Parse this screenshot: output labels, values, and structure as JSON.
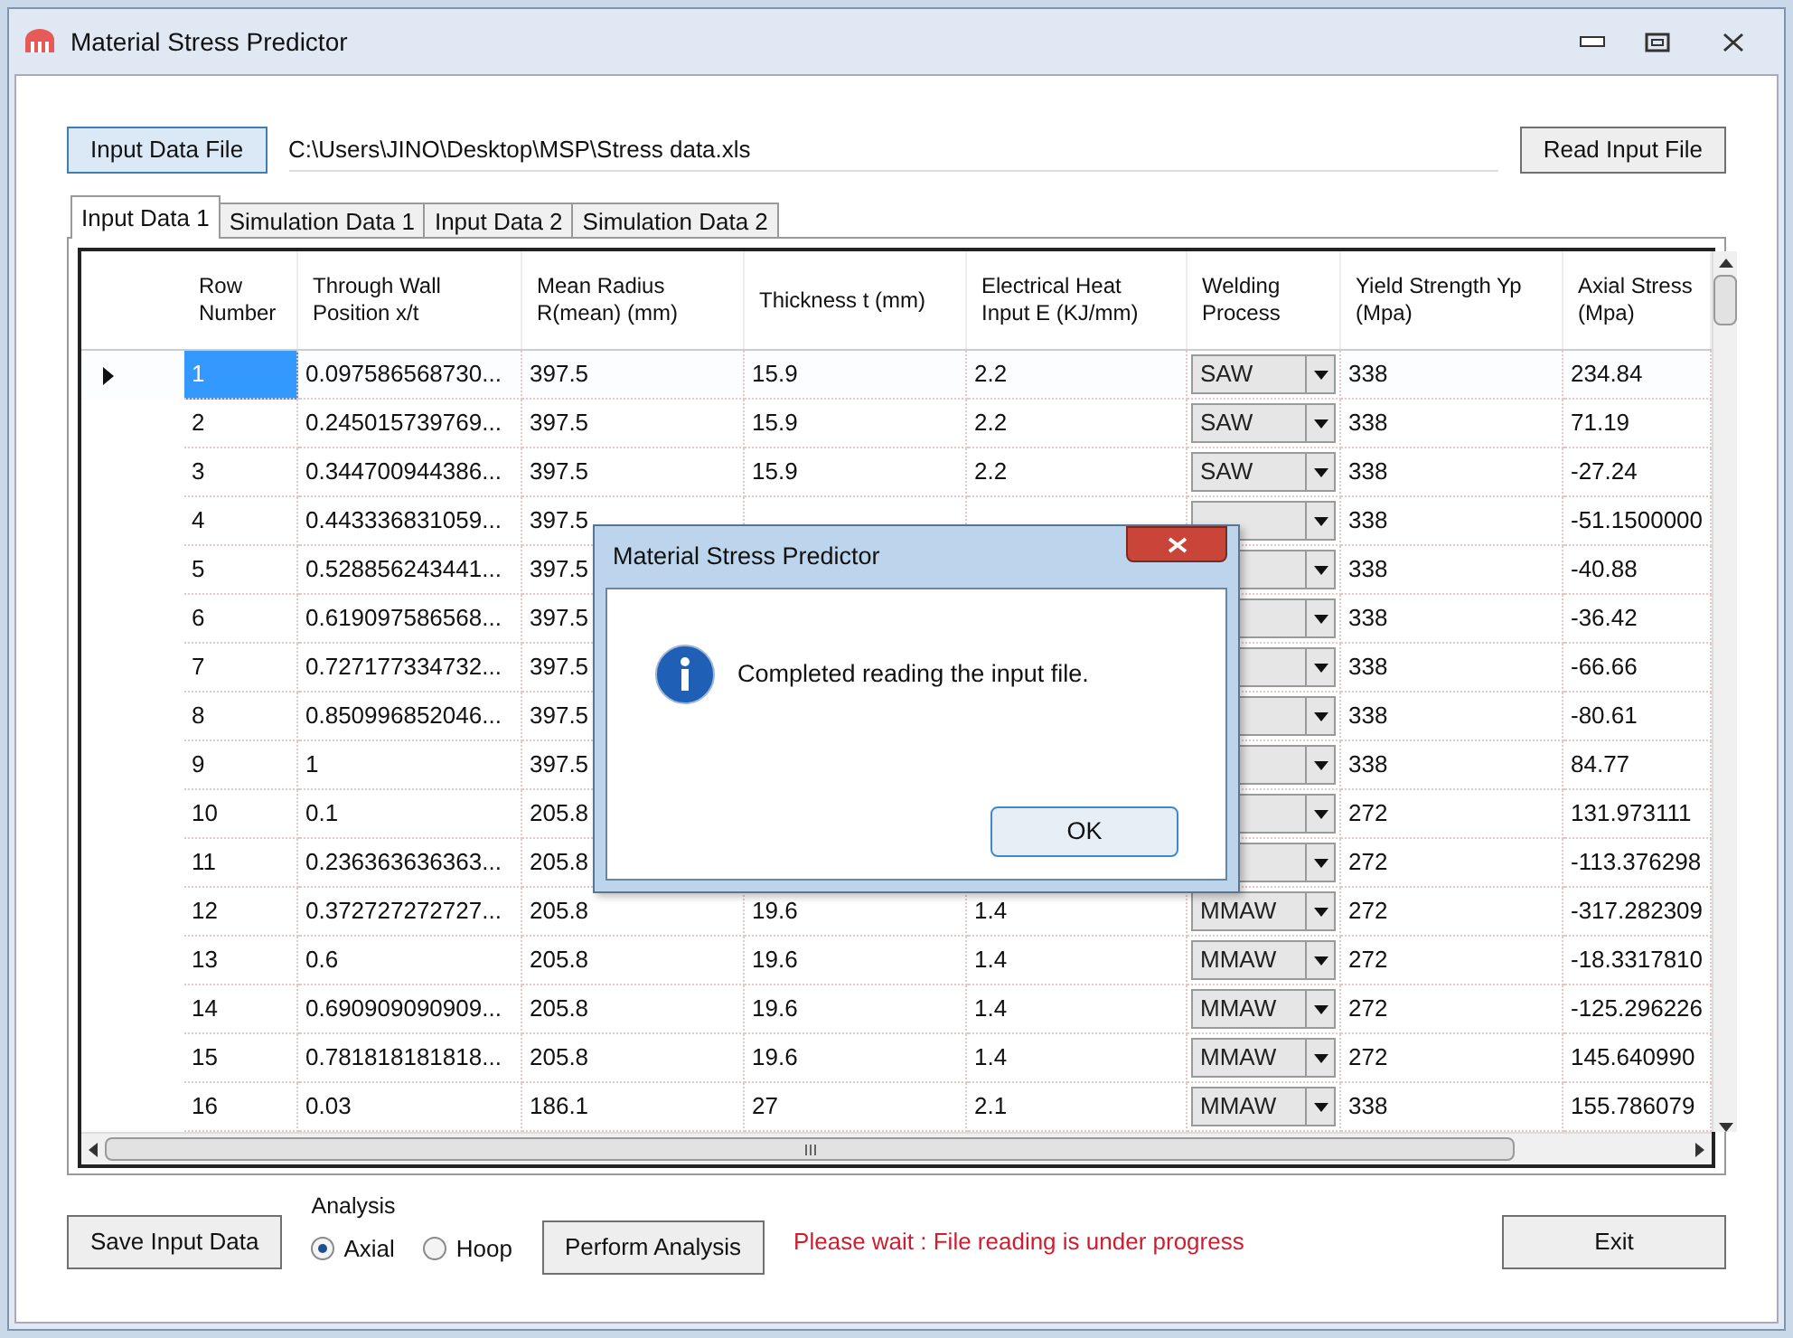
{
  "window": {
    "title": "Material Stress Predictor"
  },
  "input_file": {
    "button": "Input Data File",
    "path": "C:\\Users\\JINO\\Desktop\\MSP\\Stress data.xls",
    "read_button": "Read Input File"
  },
  "tabs": [
    {
      "label": "Input Data 1",
      "selected": true
    },
    {
      "label": "Simulation Data 1",
      "selected": false
    },
    {
      "label": "Input Data 2",
      "selected": false
    },
    {
      "label": "Simulation Data 2",
      "selected": false
    }
  ],
  "table": {
    "columns": [
      {
        "label": "Row Number",
        "kind": "text"
      },
      {
        "label": "Through Wall Position x/t",
        "kind": "text"
      },
      {
        "label": "Mean Radius R(mean) (mm)",
        "kind": "text"
      },
      {
        "label": "Thickness t (mm)",
        "kind": "text"
      },
      {
        "label": "Electrical Heat Input E (KJ/mm)",
        "kind": "text"
      },
      {
        "label": "Welding Process",
        "kind": "dropdown"
      },
      {
        "label": "Yield Strength Yp (Mpa)",
        "kind": "text"
      },
      {
        "label": "Axial Stress (Mpa)",
        "kind": "text"
      }
    ],
    "rows": [
      {
        "selected": true,
        "cells": [
          "1",
          "0.097586568730...",
          "397.5",
          "15.9",
          "2.2",
          "SAW",
          "338",
          "234.84"
        ]
      },
      {
        "selected": false,
        "cells": [
          "2",
          "0.245015739769...",
          "397.5",
          "15.9",
          "2.2",
          "SAW",
          "338",
          "71.19"
        ]
      },
      {
        "selected": false,
        "cells": [
          "3",
          "0.344700944386...",
          "397.5",
          "15.9",
          "2.2",
          "SAW",
          "338",
          "-27.24"
        ]
      },
      {
        "selected": false,
        "cells": [
          "4",
          "0.443336831059...",
          "397.5",
          null,
          null,
          null,
          "338",
          "-51.1500000"
        ]
      },
      {
        "selected": false,
        "cells": [
          "5",
          "0.528856243441...",
          "397.5",
          null,
          null,
          null,
          "338",
          "-40.88"
        ]
      },
      {
        "selected": false,
        "cells": [
          "6",
          "0.619097586568...",
          "397.5",
          null,
          null,
          null,
          "338",
          "-36.42"
        ]
      },
      {
        "selected": false,
        "cells": [
          "7",
          "0.727177334732...",
          "397.5",
          null,
          null,
          null,
          "338",
          "-66.66"
        ]
      },
      {
        "selected": false,
        "cells": [
          "8",
          "0.850996852046...",
          "397.5",
          null,
          null,
          null,
          "338",
          "-80.61"
        ]
      },
      {
        "selected": false,
        "cells": [
          "9",
          "1",
          "397.5",
          null,
          null,
          null,
          "338",
          "84.77"
        ]
      },
      {
        "selected": false,
        "cells": [
          "10",
          "0.1",
          "205.8",
          null,
          null,
          null,
          "272",
          "131.973111"
        ]
      },
      {
        "selected": false,
        "cells": [
          "11",
          "0.236363636363...",
          "205.8",
          null,
          null,
          null,
          "272",
          "-113.376298"
        ]
      },
      {
        "selected": false,
        "cells": [
          "12",
          "0.372727272727...",
          "205.8",
          "19.6",
          "1.4",
          "MMAW",
          "272",
          "-317.282309"
        ]
      },
      {
        "selected": false,
        "cells": [
          "13",
          "0.6",
          "205.8",
          "19.6",
          "1.4",
          "MMAW",
          "272",
          "-18.3317810"
        ]
      },
      {
        "selected": false,
        "cells": [
          "14",
          "0.690909090909...",
          "205.8",
          "19.6",
          "1.4",
          "MMAW",
          "272",
          "-125.296226"
        ]
      },
      {
        "selected": false,
        "cells": [
          "15",
          "0.781818181818...",
          "205.8",
          "19.6",
          "1.4",
          "MMAW",
          "272",
          "145.640990"
        ]
      },
      {
        "selected": false,
        "cells": [
          "16",
          "0.03",
          "186.1",
          "27",
          "2.1",
          "MMAW",
          "338",
          "155.786079"
        ]
      }
    ]
  },
  "bottom": {
    "save_button": "Save Input Data",
    "analysis": {
      "label": "Analysis",
      "options": [
        {
          "label": "Axial",
          "selected": true
        },
        {
          "label": "Hoop",
          "selected": false
        }
      ]
    },
    "perform_button": "Perform Analysis",
    "status": "Please wait : File reading is under progress",
    "exit_button": "Exit"
  },
  "dialog": {
    "title": "Material Stress Predictor",
    "message": "Completed reading the input file.",
    "ok_button": "OK"
  }
}
